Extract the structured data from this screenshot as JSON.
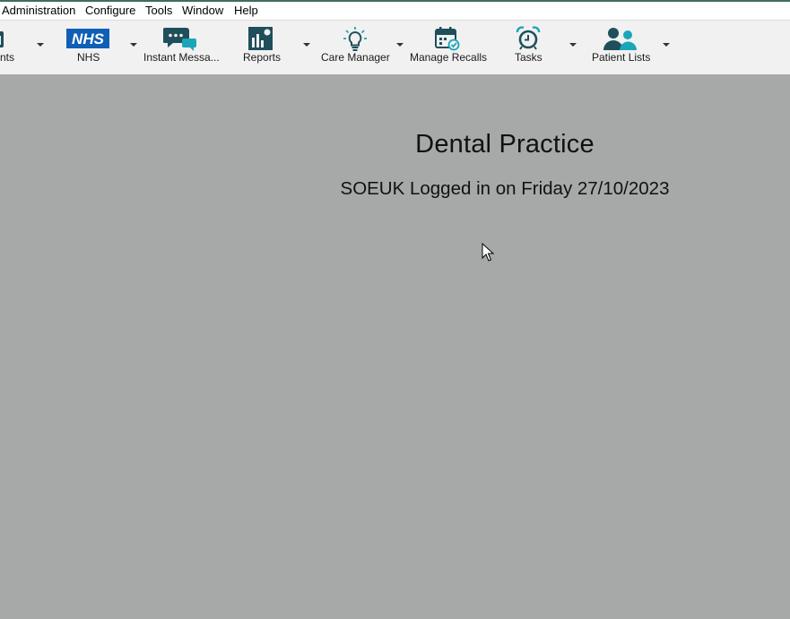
{
  "menu": {
    "items": [
      "Administration",
      "Configure",
      "Tools",
      "Window",
      "Help"
    ]
  },
  "toolbar": {
    "items": [
      {
        "label": "nts",
        "icon": "appointments-icon"
      },
      {
        "label": "NHS",
        "icon": "nhs-logo-icon"
      },
      {
        "label": "Instant Messa...",
        "icon": "chat-bubbles-icon"
      },
      {
        "label": "Reports",
        "icon": "bar-chart-icon"
      },
      {
        "label": "Care Manager",
        "icon": "lightbulb-icon"
      },
      {
        "label": "Manage Recalls",
        "icon": "calendar-check-icon"
      },
      {
        "label": "Tasks",
        "icon": "alarm-clock-icon"
      },
      {
        "label": "Patient Lists",
        "icon": "people-icon"
      }
    ]
  },
  "main": {
    "practice_name": "Dental Practice",
    "login_status": "SOEUK Logged in on Friday 27/10/2023"
  },
  "colors": {
    "icon_dark": "#1e4f5a",
    "icon_teal": "#1aa6b8",
    "nhs_blue": "#0f5fb7",
    "workspace_bg": "#a7a9a9"
  }
}
